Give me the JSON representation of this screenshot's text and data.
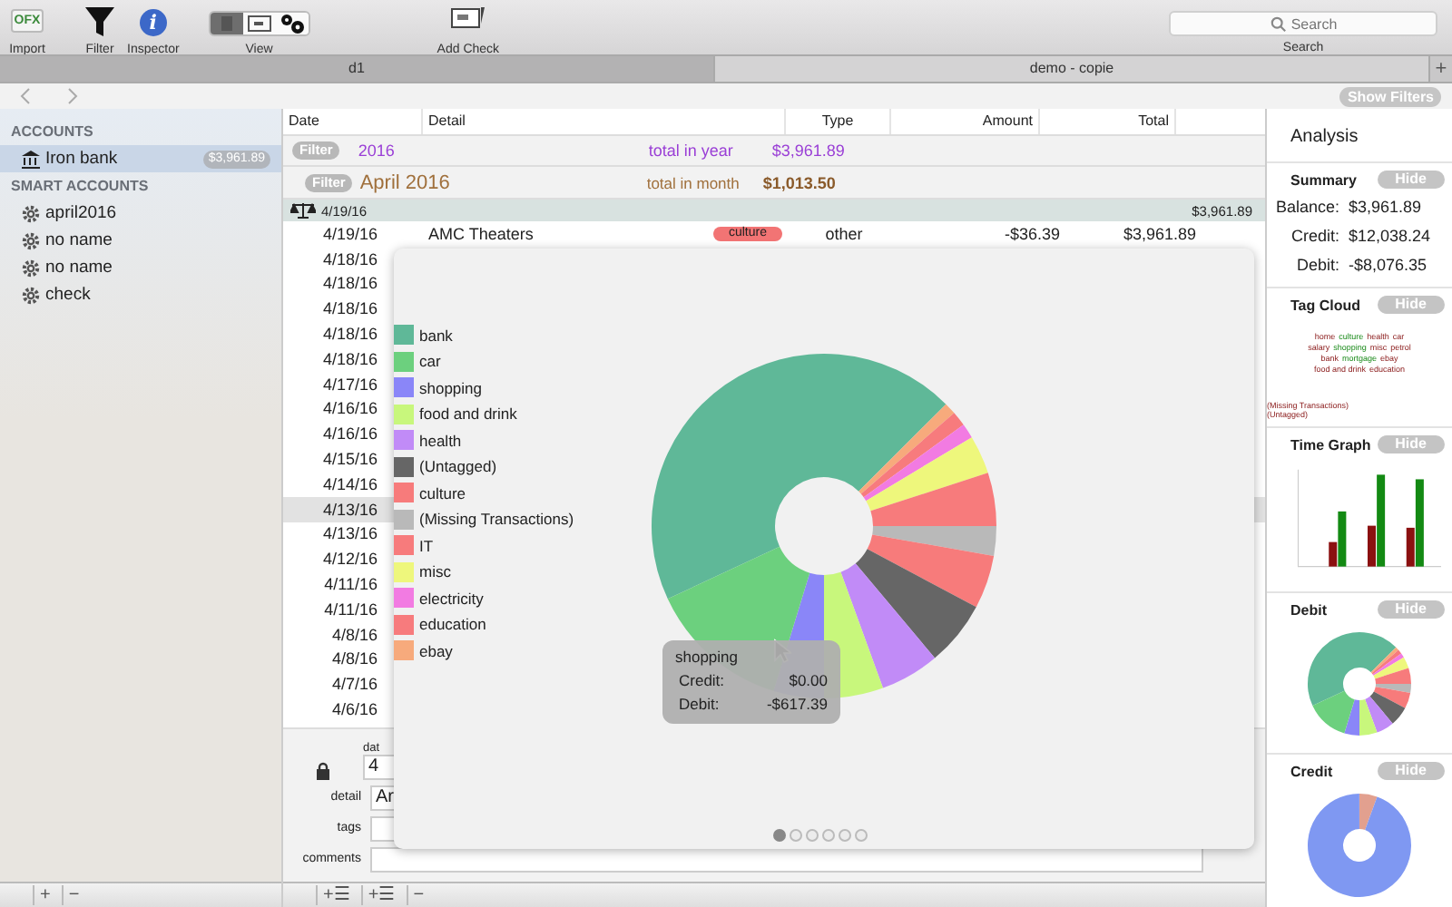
{
  "toolbar": {
    "items": [
      {
        "kind": "import",
        "label": "Import",
        "glyph": "OFX"
      },
      {
        "kind": "filter",
        "label": "Filter"
      },
      {
        "kind": "inspector",
        "label": "Inspector",
        "glyph": "i"
      },
      {
        "kind": "view",
        "label": "View",
        "segments": [
          {
            "selected": true
          },
          {
            "selected": false
          },
          {
            "selected": false
          }
        ]
      },
      {
        "kind": "check",
        "label": "Add Check"
      }
    ],
    "search": {
      "placeholder": "Search",
      "label": "Search"
    }
  },
  "tabs": [
    {
      "label": "d1",
      "selected": true
    },
    {
      "label": "demo - copie",
      "selected": false
    }
  ],
  "add_tab": "+",
  "show_filters": "Show Filters",
  "sidebar": {
    "sections": [
      {
        "title": "ACCOUNTS",
        "items": [
          {
            "kind": "bank",
            "name": "Iron bank",
            "badge": "$3,961.89",
            "selected": true
          }
        ]
      },
      {
        "title": "SMART ACCOUNTS",
        "items": [
          {
            "kind": "smart",
            "name": "april2016",
            "selected": false
          },
          {
            "kind": "smart",
            "name": "no name",
            "selected": false
          },
          {
            "kind": "smart",
            "name": "no name",
            "selected": false
          },
          {
            "kind": "smart",
            "name": "check",
            "selected": false
          }
        ]
      }
    ],
    "bottom_buttons": [
      "+",
      "−"
    ]
  },
  "table": {
    "columns": [
      "Date",
      "Detail",
      "Type",
      "Amount",
      "Total"
    ],
    "filters": [
      {
        "kind": "year",
        "button": "Filter",
        "period": "2016",
        "label": "total in year",
        "total": "$3,961.89"
      },
      {
        "kind": "month",
        "button": "Filter",
        "period": "April 2016",
        "label": "total in month",
        "total": "$1,013.50"
      }
    ],
    "group": {
      "date": "4/19/16",
      "total": "$3,961.89"
    },
    "rows": [
      {
        "date": "4/19/16",
        "detail": "AMC Theaters",
        "tag": "culture",
        "type": "other",
        "amount": "-$36.39",
        "total": "$3,961.89",
        "selected": false
      },
      {
        "date": "4/18/16",
        "selected": false
      },
      {
        "date": "4/18/16",
        "selected": false
      },
      {
        "date": "4/18/16",
        "selected": false
      },
      {
        "date": "4/18/16",
        "selected": false
      },
      {
        "date": "4/18/16",
        "selected": false
      },
      {
        "date": "4/17/16",
        "selected": false
      },
      {
        "date": "4/16/16",
        "selected": false
      },
      {
        "date": "4/16/16",
        "selected": false
      },
      {
        "date": "4/15/16",
        "selected": false
      },
      {
        "date": "4/14/16",
        "selected": false
      },
      {
        "date": "4/13/16",
        "selected": true
      },
      {
        "date": "4/13/16",
        "selected": false
      },
      {
        "date": "4/12/16",
        "selected": false
      },
      {
        "date": "4/11/16",
        "selected": false
      },
      {
        "date": "4/11/16",
        "selected": false
      },
      {
        "date": "4/8/16",
        "selected": false
      },
      {
        "date": "4/8/16",
        "selected": false
      },
      {
        "date": "4/7/16",
        "selected": false
      },
      {
        "date": "4/6/16",
        "selected": false
      }
    ]
  },
  "editor": {
    "date_label": "dat",
    "date_value": "4",
    "detail_label": "detail",
    "detail_value": "Ar",
    "tags_label": "tags",
    "comments_label": "comments"
  },
  "table_bottom_buttons": [
    "+☰",
    "+☰",
    "−"
  ],
  "popover": {
    "legend": [
      {
        "name": "bank",
        "color": "#5fb898"
      },
      {
        "name": "car",
        "color": "#6cd07e"
      },
      {
        "name": "shopping",
        "color": "#8a86f8"
      },
      {
        "name": "food and drink",
        "color": "#c8f77c"
      },
      {
        "name": "health",
        "color": "#c18bf7"
      },
      {
        "name": "(Untagged)",
        "color": "#666666"
      },
      {
        "name": "culture",
        "color": "#f77b7b"
      },
      {
        "name": "(Missing Transactions)",
        "color": "#b9b9b9"
      },
      {
        "name": "IT",
        "color": "#f77b7c"
      },
      {
        "name": "misc",
        "color": "#eef77c"
      },
      {
        "name": "electricity",
        "color": "#f27be2"
      },
      {
        "name": "education",
        "color": "#f77b7d"
      },
      {
        "name": "ebay",
        "color": "#f7aa7c"
      }
    ],
    "tooltip": {
      "title": "shopping",
      "lines": [
        {
          "label": "Credit:",
          "value": "$0.00"
        },
        {
          "label": "Debit:",
          "value": "-$617.39"
        }
      ]
    },
    "pages": [
      {
        "selected": true
      },
      {
        "selected": false
      },
      {
        "selected": false
      },
      {
        "selected": false
      },
      {
        "selected": false
      },
      {
        "selected": false
      }
    ]
  },
  "analysis": {
    "title": "Analysis",
    "summary": {
      "title": "Summary",
      "hide": "Hide",
      "lines": [
        {
          "label": "Balance:",
          "value": "$3,961.89"
        },
        {
          "label": "Credit:",
          "value": "$12,038.24"
        },
        {
          "label": "Debit:",
          "value": "-$8,076.35"
        }
      ]
    },
    "tag_cloud": {
      "title": "Tag Cloud",
      "hide": "Hide",
      "words": [
        "home",
        "culture",
        "health",
        "car",
        "salary",
        "shopping",
        "misc",
        "petrol",
        "bank",
        "mortgage",
        "ebay",
        "food and drink",
        "education"
      ],
      "extra": [
        "(Missing Transactions)",
        "(Untagged)"
      ]
    },
    "time_graph": {
      "title": "Time Graph",
      "hide": "Hide"
    },
    "debit": {
      "title": "Debit",
      "hide": "Hide"
    },
    "credit": {
      "title": "Credit",
      "hide": "Hide"
    }
  }
}
